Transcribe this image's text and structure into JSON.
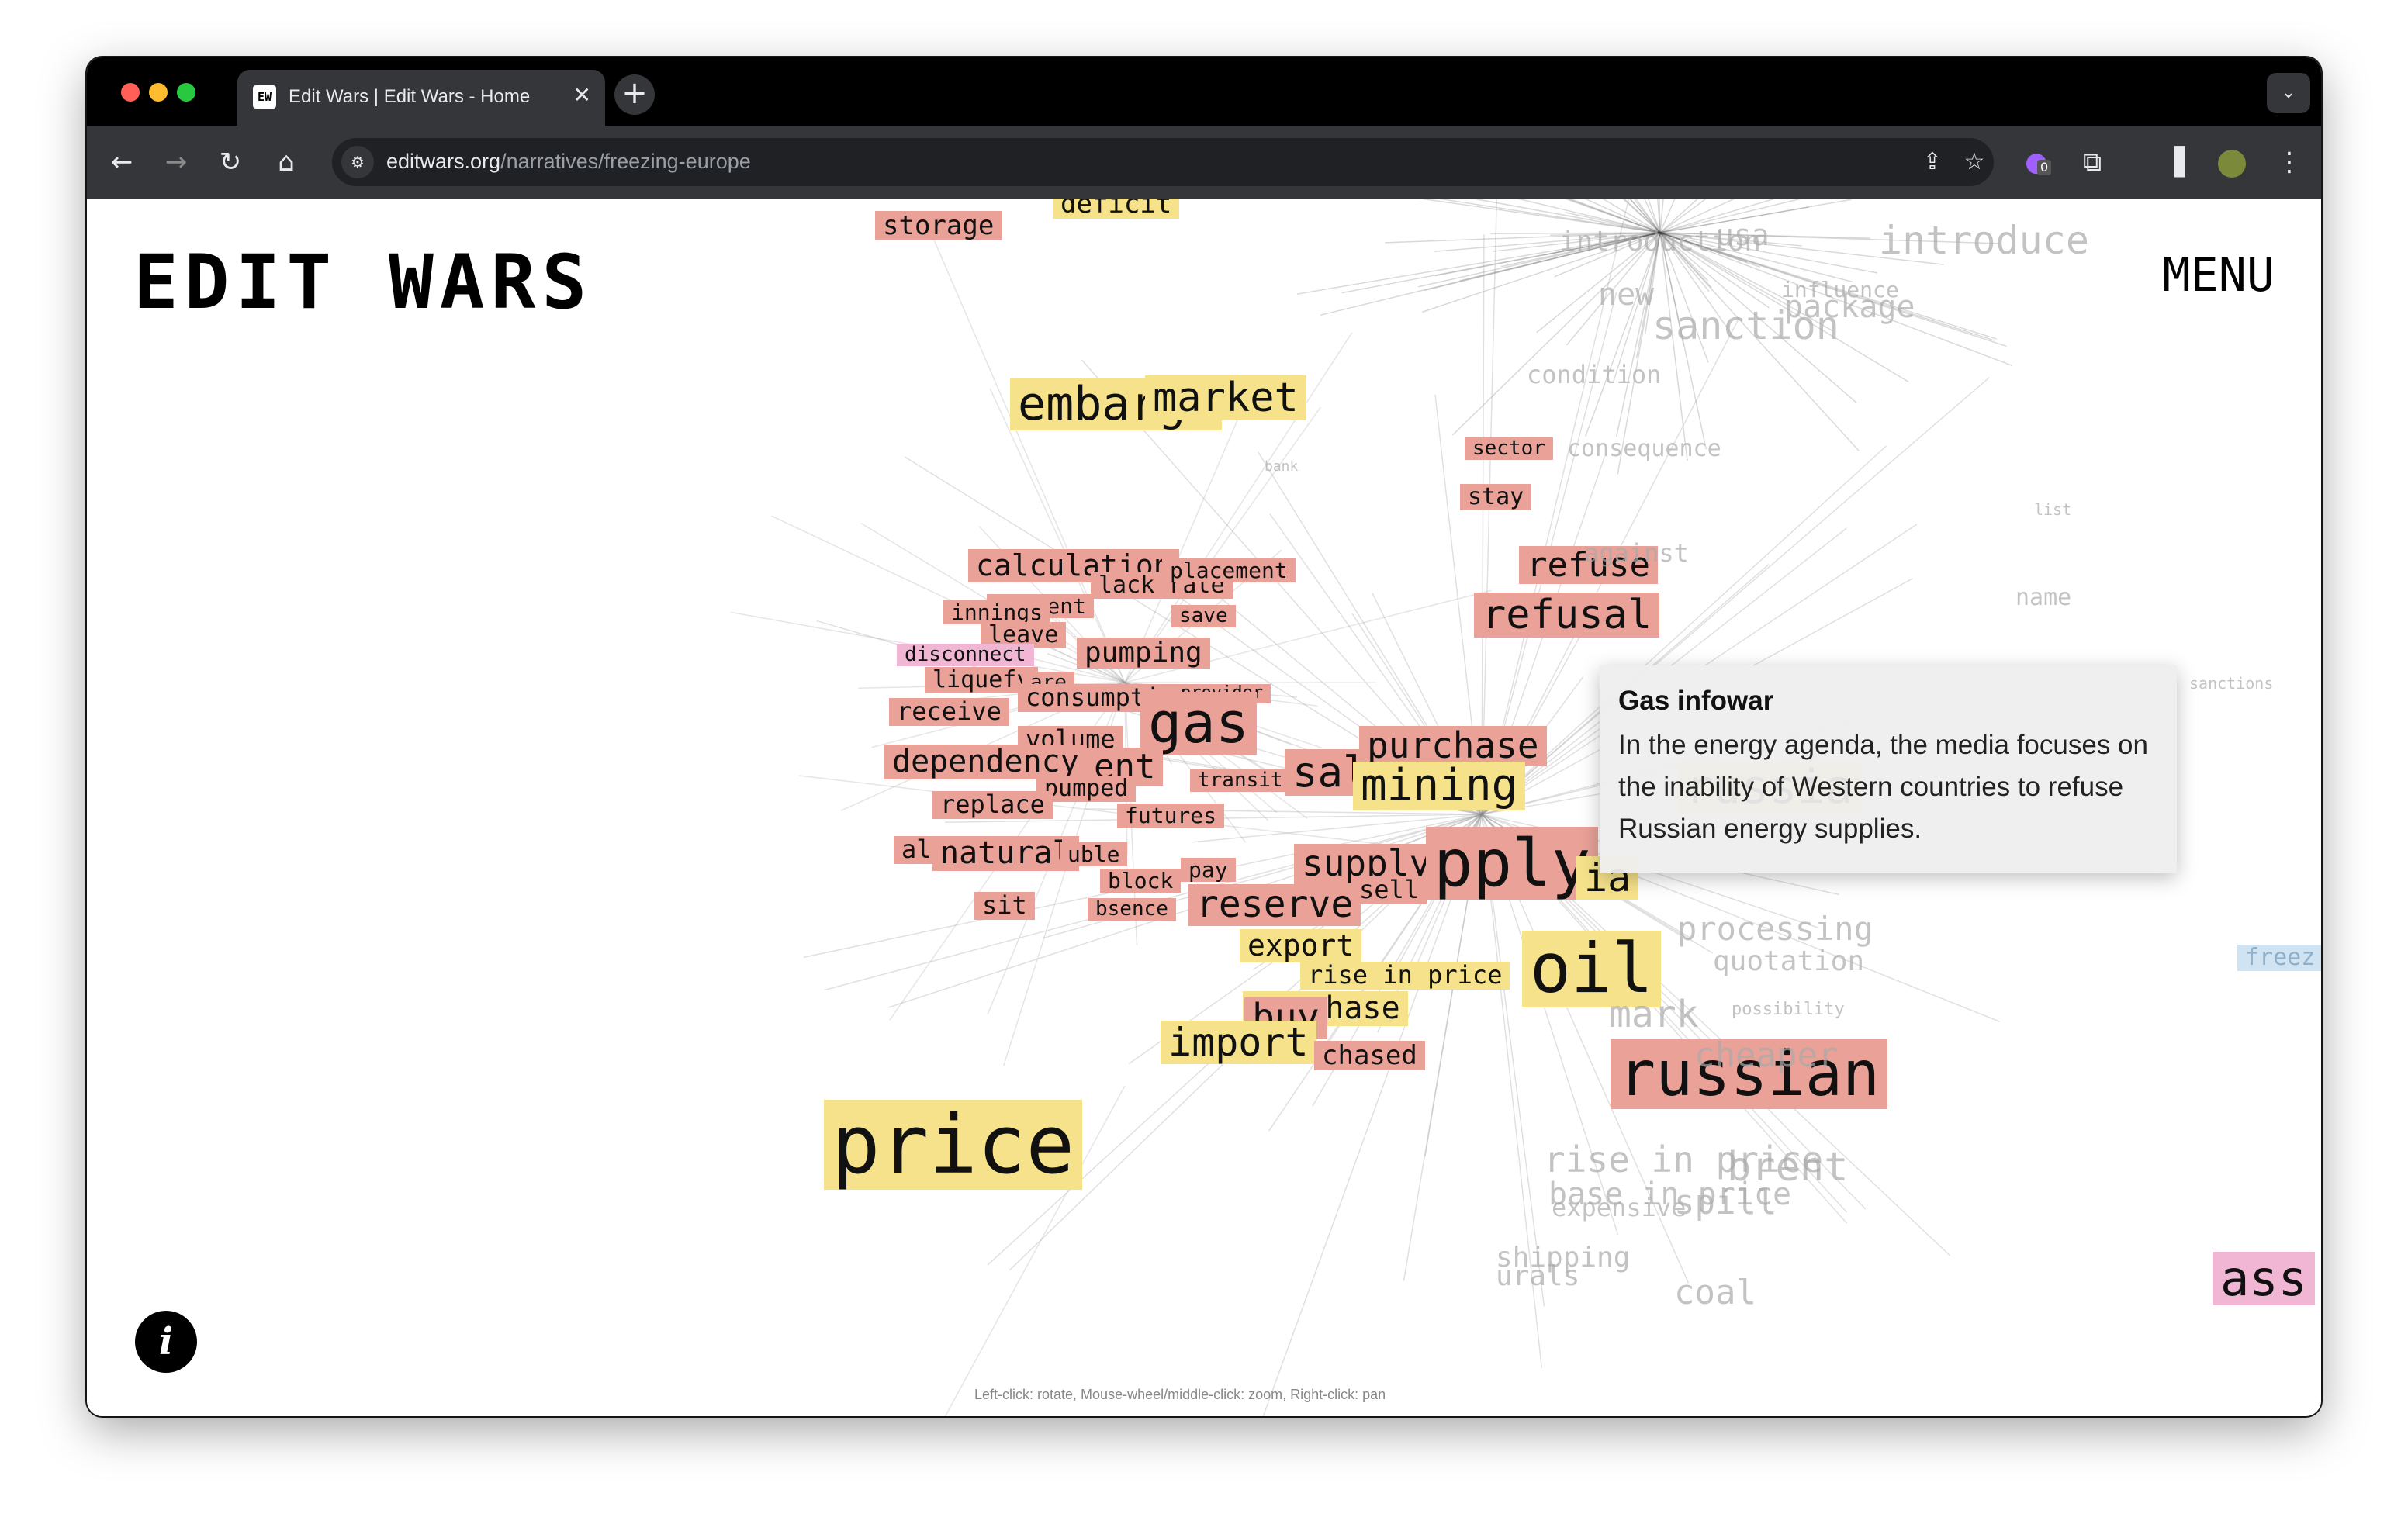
{
  "browser": {
    "tab_title": "Edit Wars | Edit Wars - Home",
    "tab_favicon": "EW",
    "url_host": "editwars.org",
    "url_path": "/narratives/freezing-europe",
    "extension_badge": "0"
  },
  "site": {
    "logo": "EDIT WARS",
    "menu_label": "MENU",
    "info_label": "i",
    "controls_hint": "Left-click: rotate, Mouse-wheel/middle-click: zoom, Right-click: pan"
  },
  "tooltip": {
    "title": "Gas infowar",
    "body": "In the energy agenda, the media focuses on the inability of Western countries to refuse Russian energy supplies."
  },
  "colors": {
    "red_node": "#e9a198",
    "yellow_node": "#f5e28a",
    "pink_node": "#f0b6d4",
    "blue_node": "#cfe3f3"
  },
  "word_cloud": {
    "words": [
      {
        "text": "storage",
        "color": "red"
      },
      {
        "text": "deficit",
        "color": "yellow"
      },
      {
        "text": "embargo",
        "color": "yellow"
      },
      {
        "text": "market",
        "color": "yellow"
      },
      {
        "text": "bank",
        "color": "none"
      },
      {
        "text": "sector",
        "color": "red"
      },
      {
        "text": "stay",
        "color": "red"
      },
      {
        "text": "refuse",
        "color": "red"
      },
      {
        "text": "refusal",
        "color": "red"
      },
      {
        "text": "against",
        "color": "none"
      },
      {
        "text": "calculation",
        "color": "red"
      },
      {
        "text": "lack rate",
        "color": "red"
      },
      {
        "text": "placement",
        "color": "red"
      },
      {
        "text": "payment",
        "color": "red"
      },
      {
        "text": "innings",
        "color": "red"
      },
      {
        "text": "leave",
        "color": "red"
      },
      {
        "text": "save",
        "color": "red"
      },
      {
        "text": "disconnect",
        "color": "pink"
      },
      {
        "text": "pumping",
        "color": "red"
      },
      {
        "text": "liquefy",
        "color": "red"
      },
      {
        "text": "are",
        "color": "red"
      },
      {
        "text": "consumption",
        "color": "red"
      },
      {
        "text": "provider",
        "color": "red"
      },
      {
        "text": "receive",
        "color": "red"
      },
      {
        "text": "gas",
        "color": "red"
      },
      {
        "text": "volume",
        "color": "red"
      },
      {
        "text": "dependency",
        "color": "red"
      },
      {
        "text": "ent",
        "color": "red"
      },
      {
        "text": "pumped",
        "color": "red"
      },
      {
        "text": "transit",
        "color": "red"
      },
      {
        "text": "sale",
        "color": "red"
      },
      {
        "text": "purchase",
        "color": "red"
      },
      {
        "text": "mining",
        "color": "yellow"
      },
      {
        "text": "russia",
        "color": "yellow"
      },
      {
        "text": "replace",
        "color": "red"
      },
      {
        "text": "futures",
        "color": "red"
      },
      {
        "text": "alt",
        "color": "red"
      },
      {
        "text": "natural",
        "color": "red"
      },
      {
        "text": "uble",
        "color": "red"
      },
      {
        "text": "block",
        "color": "red"
      },
      {
        "text": "pay",
        "color": "red"
      },
      {
        "text": "sit",
        "color": "red"
      },
      {
        "text": "bsence",
        "color": "red"
      },
      {
        "text": "reserve",
        "color": "red"
      },
      {
        "text": "supply",
        "color": "red"
      },
      {
        "text": "sell",
        "color": "red"
      },
      {
        "text": "pply",
        "color": "red"
      },
      {
        "text": "ia",
        "color": "yellow"
      },
      {
        "text": "export",
        "color": "yellow"
      },
      {
        "text": "rise in price",
        "color": "yellow"
      },
      {
        "text": "oil",
        "color": "yellow"
      },
      {
        "text": "purchase",
        "color": "yellow"
      },
      {
        "text": "buy",
        "color": "red"
      },
      {
        "text": "import",
        "color": "yellow"
      },
      {
        "text": "chased",
        "color": "red"
      },
      {
        "text": "russian",
        "color": "red"
      },
      {
        "text": "cheaper",
        "color": "none"
      },
      {
        "text": "mark",
        "color": "none"
      },
      {
        "text": "processing",
        "color": "none"
      },
      {
        "text": "quotation",
        "color": "none"
      },
      {
        "text": "possibility",
        "color": "none"
      },
      {
        "text": "price",
        "color": "yellow"
      },
      {
        "text": "rise in price",
        "color": "none"
      },
      {
        "text": "brent",
        "color": "none"
      },
      {
        "text": "base in price",
        "color": "none"
      },
      {
        "text": "spill",
        "color": "none"
      },
      {
        "text": "expensive",
        "color": "none"
      },
      {
        "text": "shipping",
        "color": "none"
      },
      {
        "text": "urals",
        "color": "none"
      },
      {
        "text": "coal",
        "color": "none"
      },
      {
        "text": "freez",
        "color": "blue"
      },
      {
        "text": "ass",
        "color": "pink"
      },
      {
        "text": "introduction",
        "color": "none"
      },
      {
        "text": "usa",
        "color": "none"
      },
      {
        "text": "introduce",
        "color": "none"
      },
      {
        "text": "new",
        "color": "none"
      },
      {
        "text": "sanction",
        "color": "none"
      },
      {
        "text": "package",
        "color": "none"
      },
      {
        "text": "influence",
        "color": "none"
      },
      {
        "text": "condition",
        "color": "none"
      },
      {
        "text": "consequence",
        "color": "none"
      },
      {
        "text": "sanctions",
        "color": "none"
      },
      {
        "text": "list",
        "color": "none"
      },
      {
        "text": "name",
        "color": "none"
      }
    ]
  }
}
